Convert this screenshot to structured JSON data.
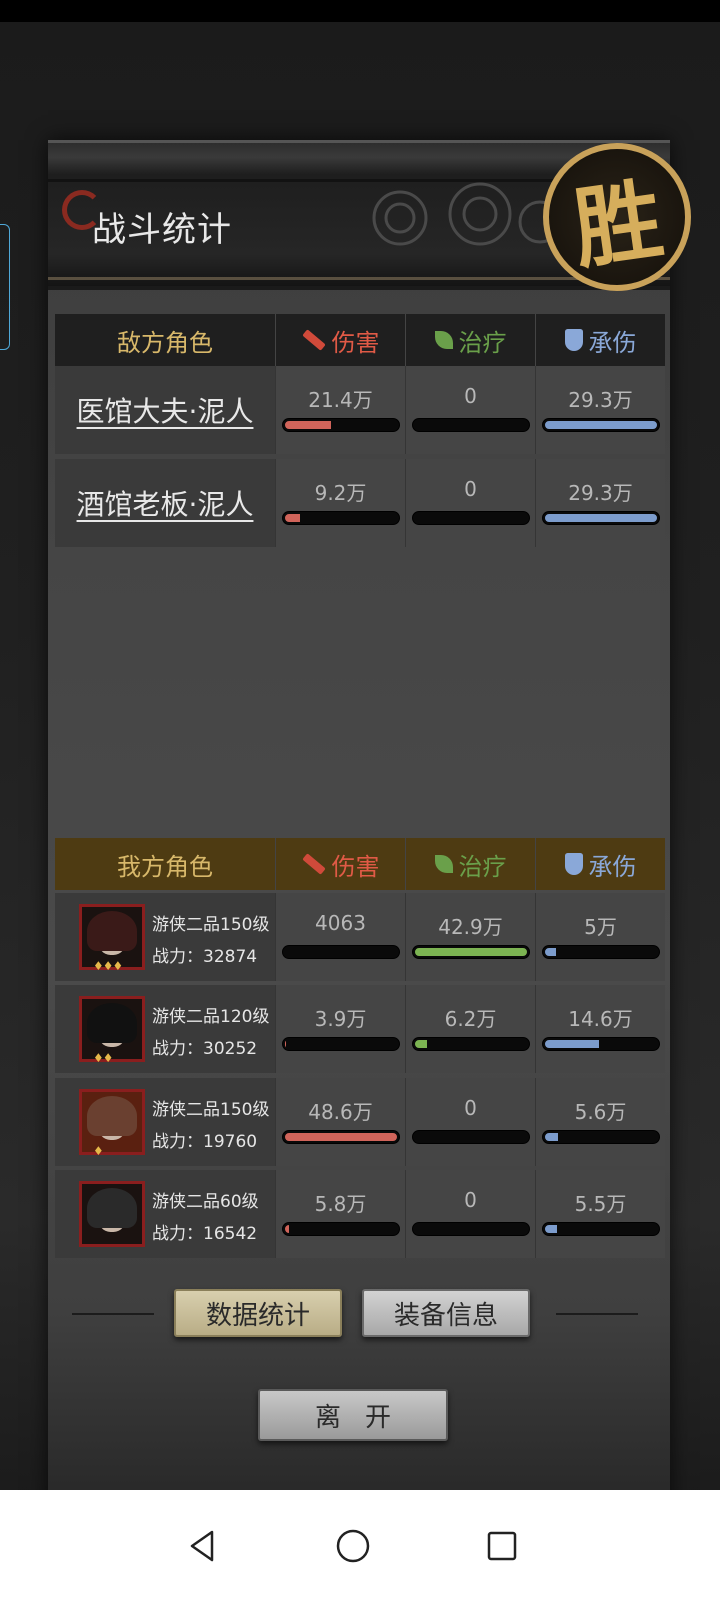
{
  "title": "战斗统计",
  "victory_glyph": "胜",
  "columns": {
    "damage": "伤害",
    "heal": "治疗",
    "taken": "承伤"
  },
  "enemy": {
    "header": "敌方角色",
    "rows": [
      {
        "name": "医馆大夫·泥人",
        "damage": "21.4万",
        "heal": "0",
        "taken": "29.3万",
        "damage_fill": 0.43,
        "heal_fill": 0,
        "taken_fill": 1.0
      },
      {
        "name": "酒馆老板·泥人",
        "damage": "9.2万",
        "heal": "0",
        "taken": "29.3万",
        "damage_fill": 0.16,
        "heal_fill": 0,
        "taken_fill": 1.0
      }
    ]
  },
  "ally": {
    "header": "我方角色",
    "rows": [
      {
        "rank": "游侠二品150级",
        "power_label": "战力：",
        "power": "32874",
        "damage": "4063",
        "heal": "42.9万",
        "taken": "5万",
        "damage_fill": 0.01,
        "heal_fill": 1.0,
        "taken_fill": 0.13,
        "stars": "♦♦♦"
      },
      {
        "rank": "游侠二品120级",
        "power_label": "战力：",
        "power": "30252",
        "damage": "3.9万",
        "heal": "6.2万",
        "taken": "14.6万",
        "damage_fill": 0.04,
        "heal_fill": 0.14,
        "taken_fill": 0.5,
        "stars": "♦♦"
      },
      {
        "rank": "游侠二品150级",
        "power_label": "战力：",
        "power": "19760",
        "damage": "48.6万",
        "heal": "0",
        "taken": "5.6万",
        "damage_fill": 1.0,
        "heal_fill": 0,
        "taken_fill": 0.15,
        "stars": "♦"
      },
      {
        "rank": "游侠二品60级",
        "power_label": "战力：",
        "power": "16542",
        "damage": "5.8万",
        "heal": "0",
        "taken": "5.5万",
        "damage_fill": 0.07,
        "heal_fill": 0,
        "taken_fill": 0.14,
        "stars": ""
      }
    ]
  },
  "buttons": {
    "stats": "数据统计",
    "equip": "装备信息",
    "leave": "离开"
  },
  "colors": {
    "damage": "#d0645a",
    "heal": "#7cb452",
    "taken": "#7c9ccc",
    "gold": "#d6ae5c"
  }
}
